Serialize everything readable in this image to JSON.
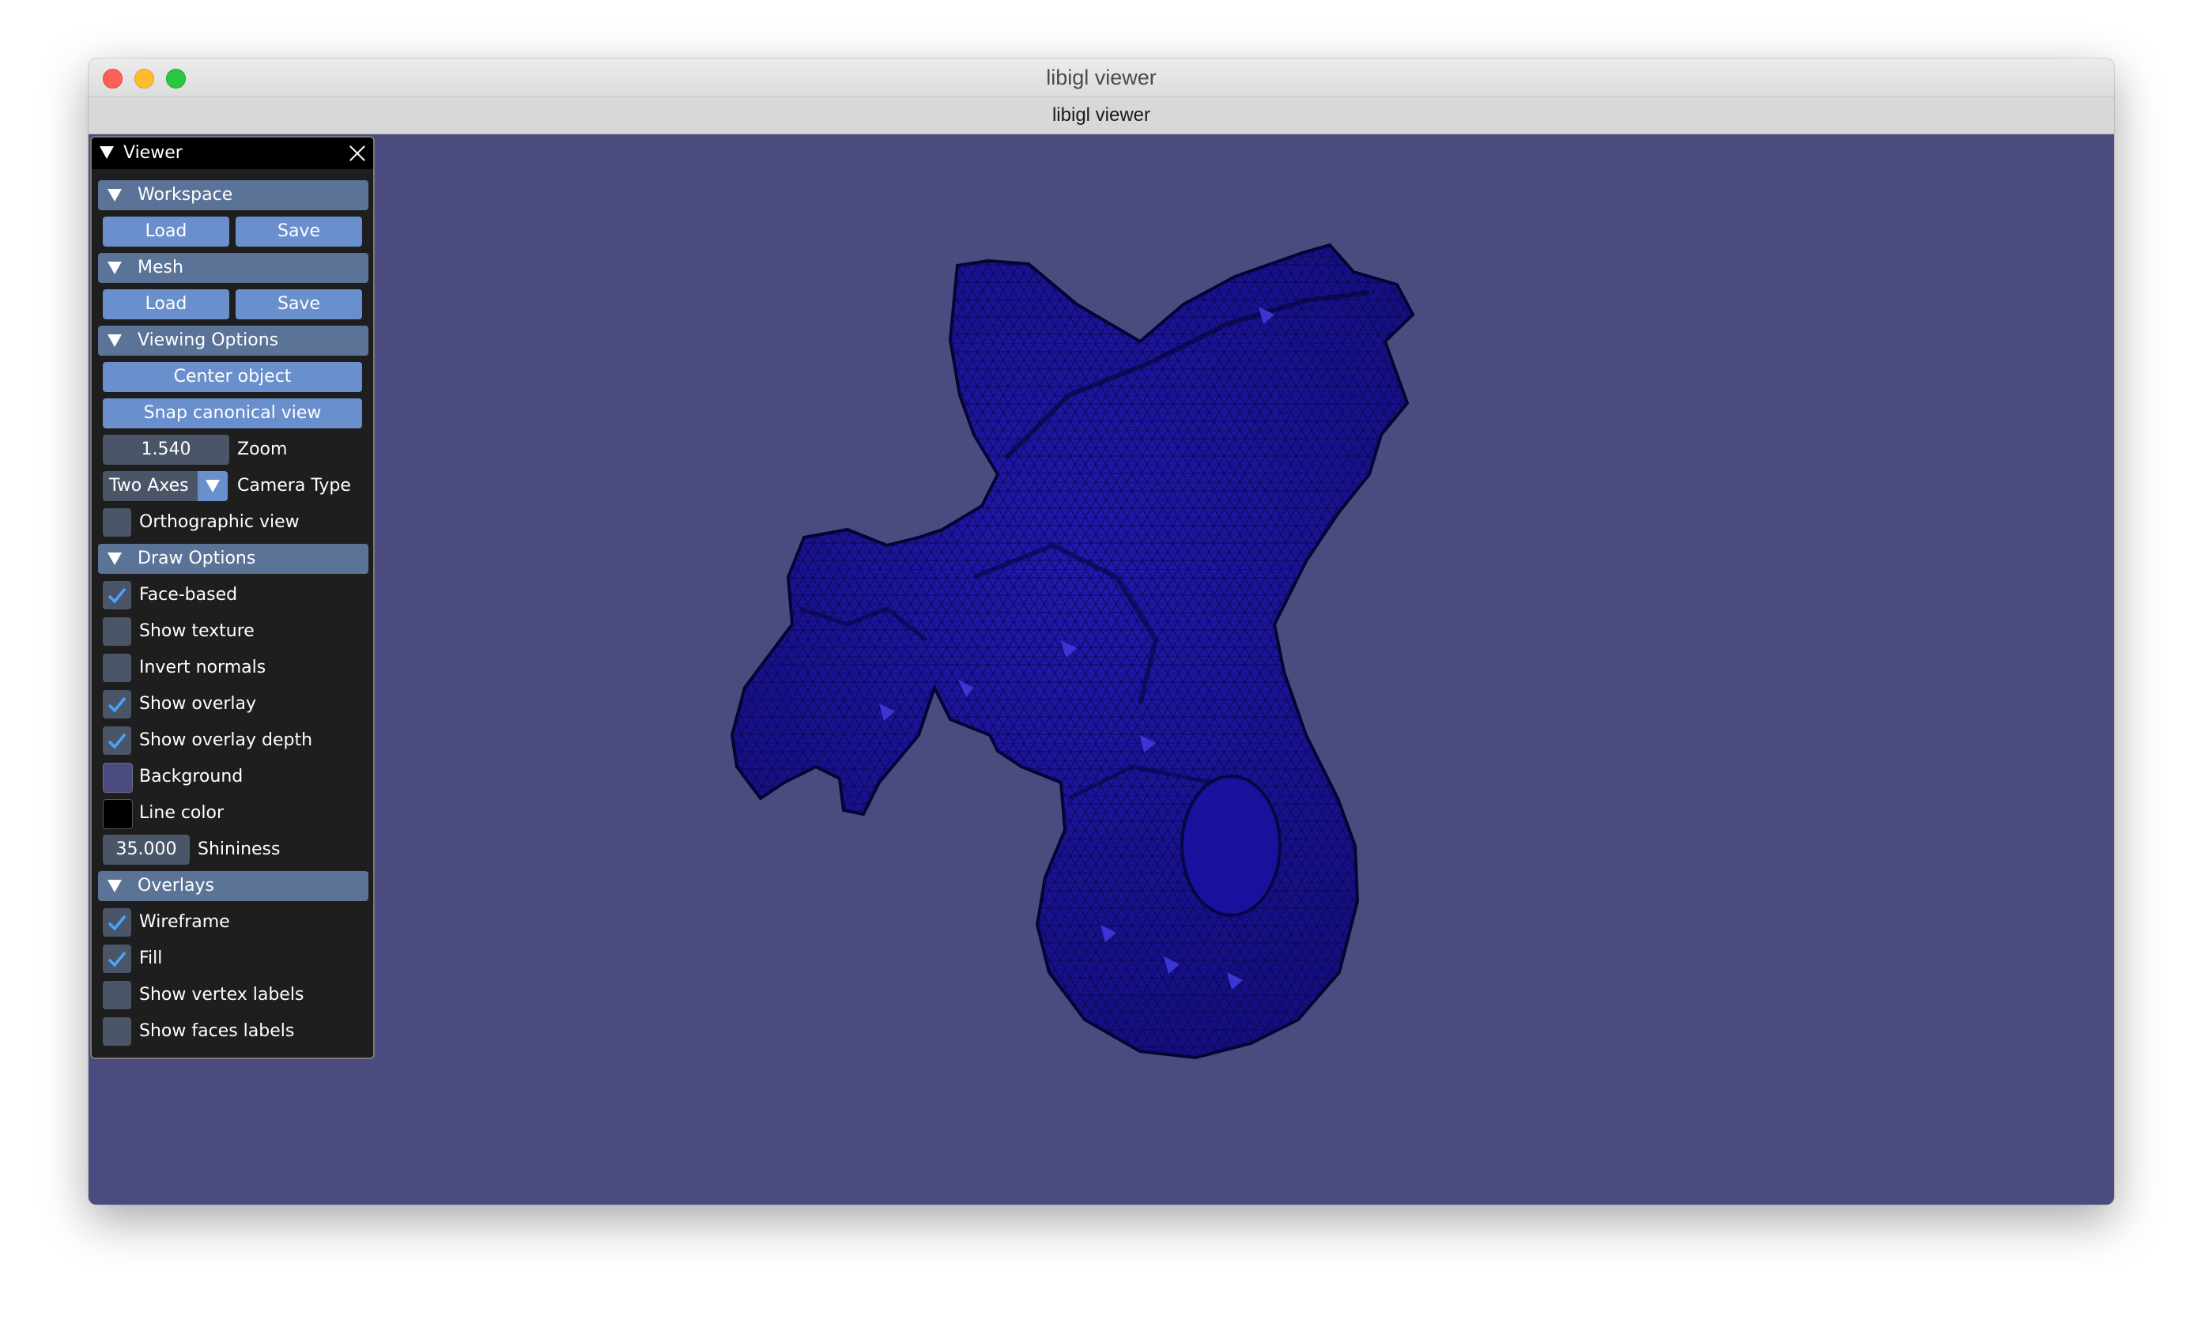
{
  "window": {
    "title": "libigl viewer",
    "tab_title": "libigl viewer"
  },
  "viewport": {
    "background_color": "#4c4b7f",
    "mesh_color": "#1b139c",
    "mesh_subject": "gargoyle mesh with wireframe overlay"
  },
  "panel": {
    "title": "Viewer",
    "sections": {
      "workspace": {
        "label": "Workspace",
        "load": "Load",
        "save": "Save"
      },
      "mesh": {
        "label": "Mesh",
        "load": "Load",
        "save": "Save"
      },
      "viewing": {
        "label": "Viewing Options",
        "center_object": "Center object",
        "snap_view": "Snap canonical view",
        "zoom_value": "1.540",
        "zoom_label": "Zoom",
        "camera_value": "Two Axes",
        "camera_label": "Camera Type",
        "orthographic": {
          "label": "Orthographic view",
          "checked": false
        }
      },
      "draw": {
        "label": "Draw Options",
        "face_based": {
          "label": "Face-based",
          "checked": true
        },
        "show_texture": {
          "label": "Show texture",
          "checked": false
        },
        "invert_normals": {
          "label": "Invert normals",
          "checked": false
        },
        "show_overlay": {
          "label": "Show overlay",
          "checked": true
        },
        "show_overlay_depth": {
          "label": "Show overlay depth",
          "checked": true
        },
        "background": {
          "label": "Background",
          "color": "#4c4b7f"
        },
        "line_color": {
          "label": "Line color",
          "color": "#000000"
        },
        "shininess_value": "35.000",
        "shininess_label": "Shininess"
      },
      "overlays": {
        "label": "Overlays",
        "wireframe": {
          "label": "Wireframe",
          "checked": true
        },
        "fill": {
          "label": "Fill",
          "checked": true
        },
        "vertex_labels": {
          "label": "Show vertex labels",
          "checked": false
        },
        "faces_labels": {
          "label": "Show faces labels",
          "checked": false
        }
      }
    }
  }
}
